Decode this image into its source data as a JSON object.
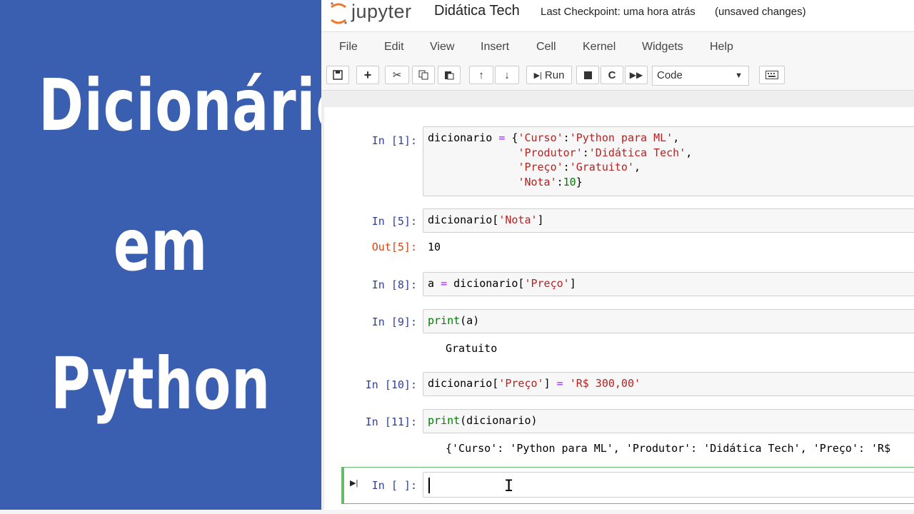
{
  "slide": {
    "title_lines": [
      "Dicionários",
      "em",
      "Python"
    ]
  },
  "header": {
    "logo_text": "jupyter",
    "notebook_title": "Didática Tech",
    "checkpoint": "Last Checkpoint: uma hora atrás",
    "status": "(unsaved changes)"
  },
  "menu": [
    "File",
    "Edit",
    "View",
    "Insert",
    "Cell",
    "Kernel",
    "Widgets",
    "Help"
  ],
  "toolbar": {
    "run_label": "Run",
    "cell_type": "Code"
  },
  "cells": [
    {
      "prompt": "In [1]:",
      "lines": [
        "dicionario = {'Curso':'Python para ML',",
        "              'Produtor':'Didática Tech',",
        "              'Preço':'Gratuito',",
        "              'Nota':10}"
      ]
    },
    {
      "prompt": "In [5]:",
      "lines": [
        "dicionario['Nota']"
      ],
      "out_prompt": "Out[5]:",
      "output": "10"
    },
    {
      "prompt": "In [8]:",
      "lines": [
        "a = dicionario['Preço']"
      ]
    },
    {
      "prompt": "In [9]:",
      "lines": [
        "print(a)"
      ],
      "output": "Gratuito"
    },
    {
      "prompt": "In [10]:",
      "lines": [
        "dicionario['Preço'] = 'R$ 300,00'"
      ]
    },
    {
      "prompt": "In [11]:",
      "lines": [
        "print(dicionario)"
      ],
      "output": "{'Curso': 'Python para ML', 'Produtor': 'Didática Tech', 'Preço': 'R$"
    },
    {
      "prompt": "In [ ]:",
      "lines": [
        ""
      ]
    }
  ]
}
